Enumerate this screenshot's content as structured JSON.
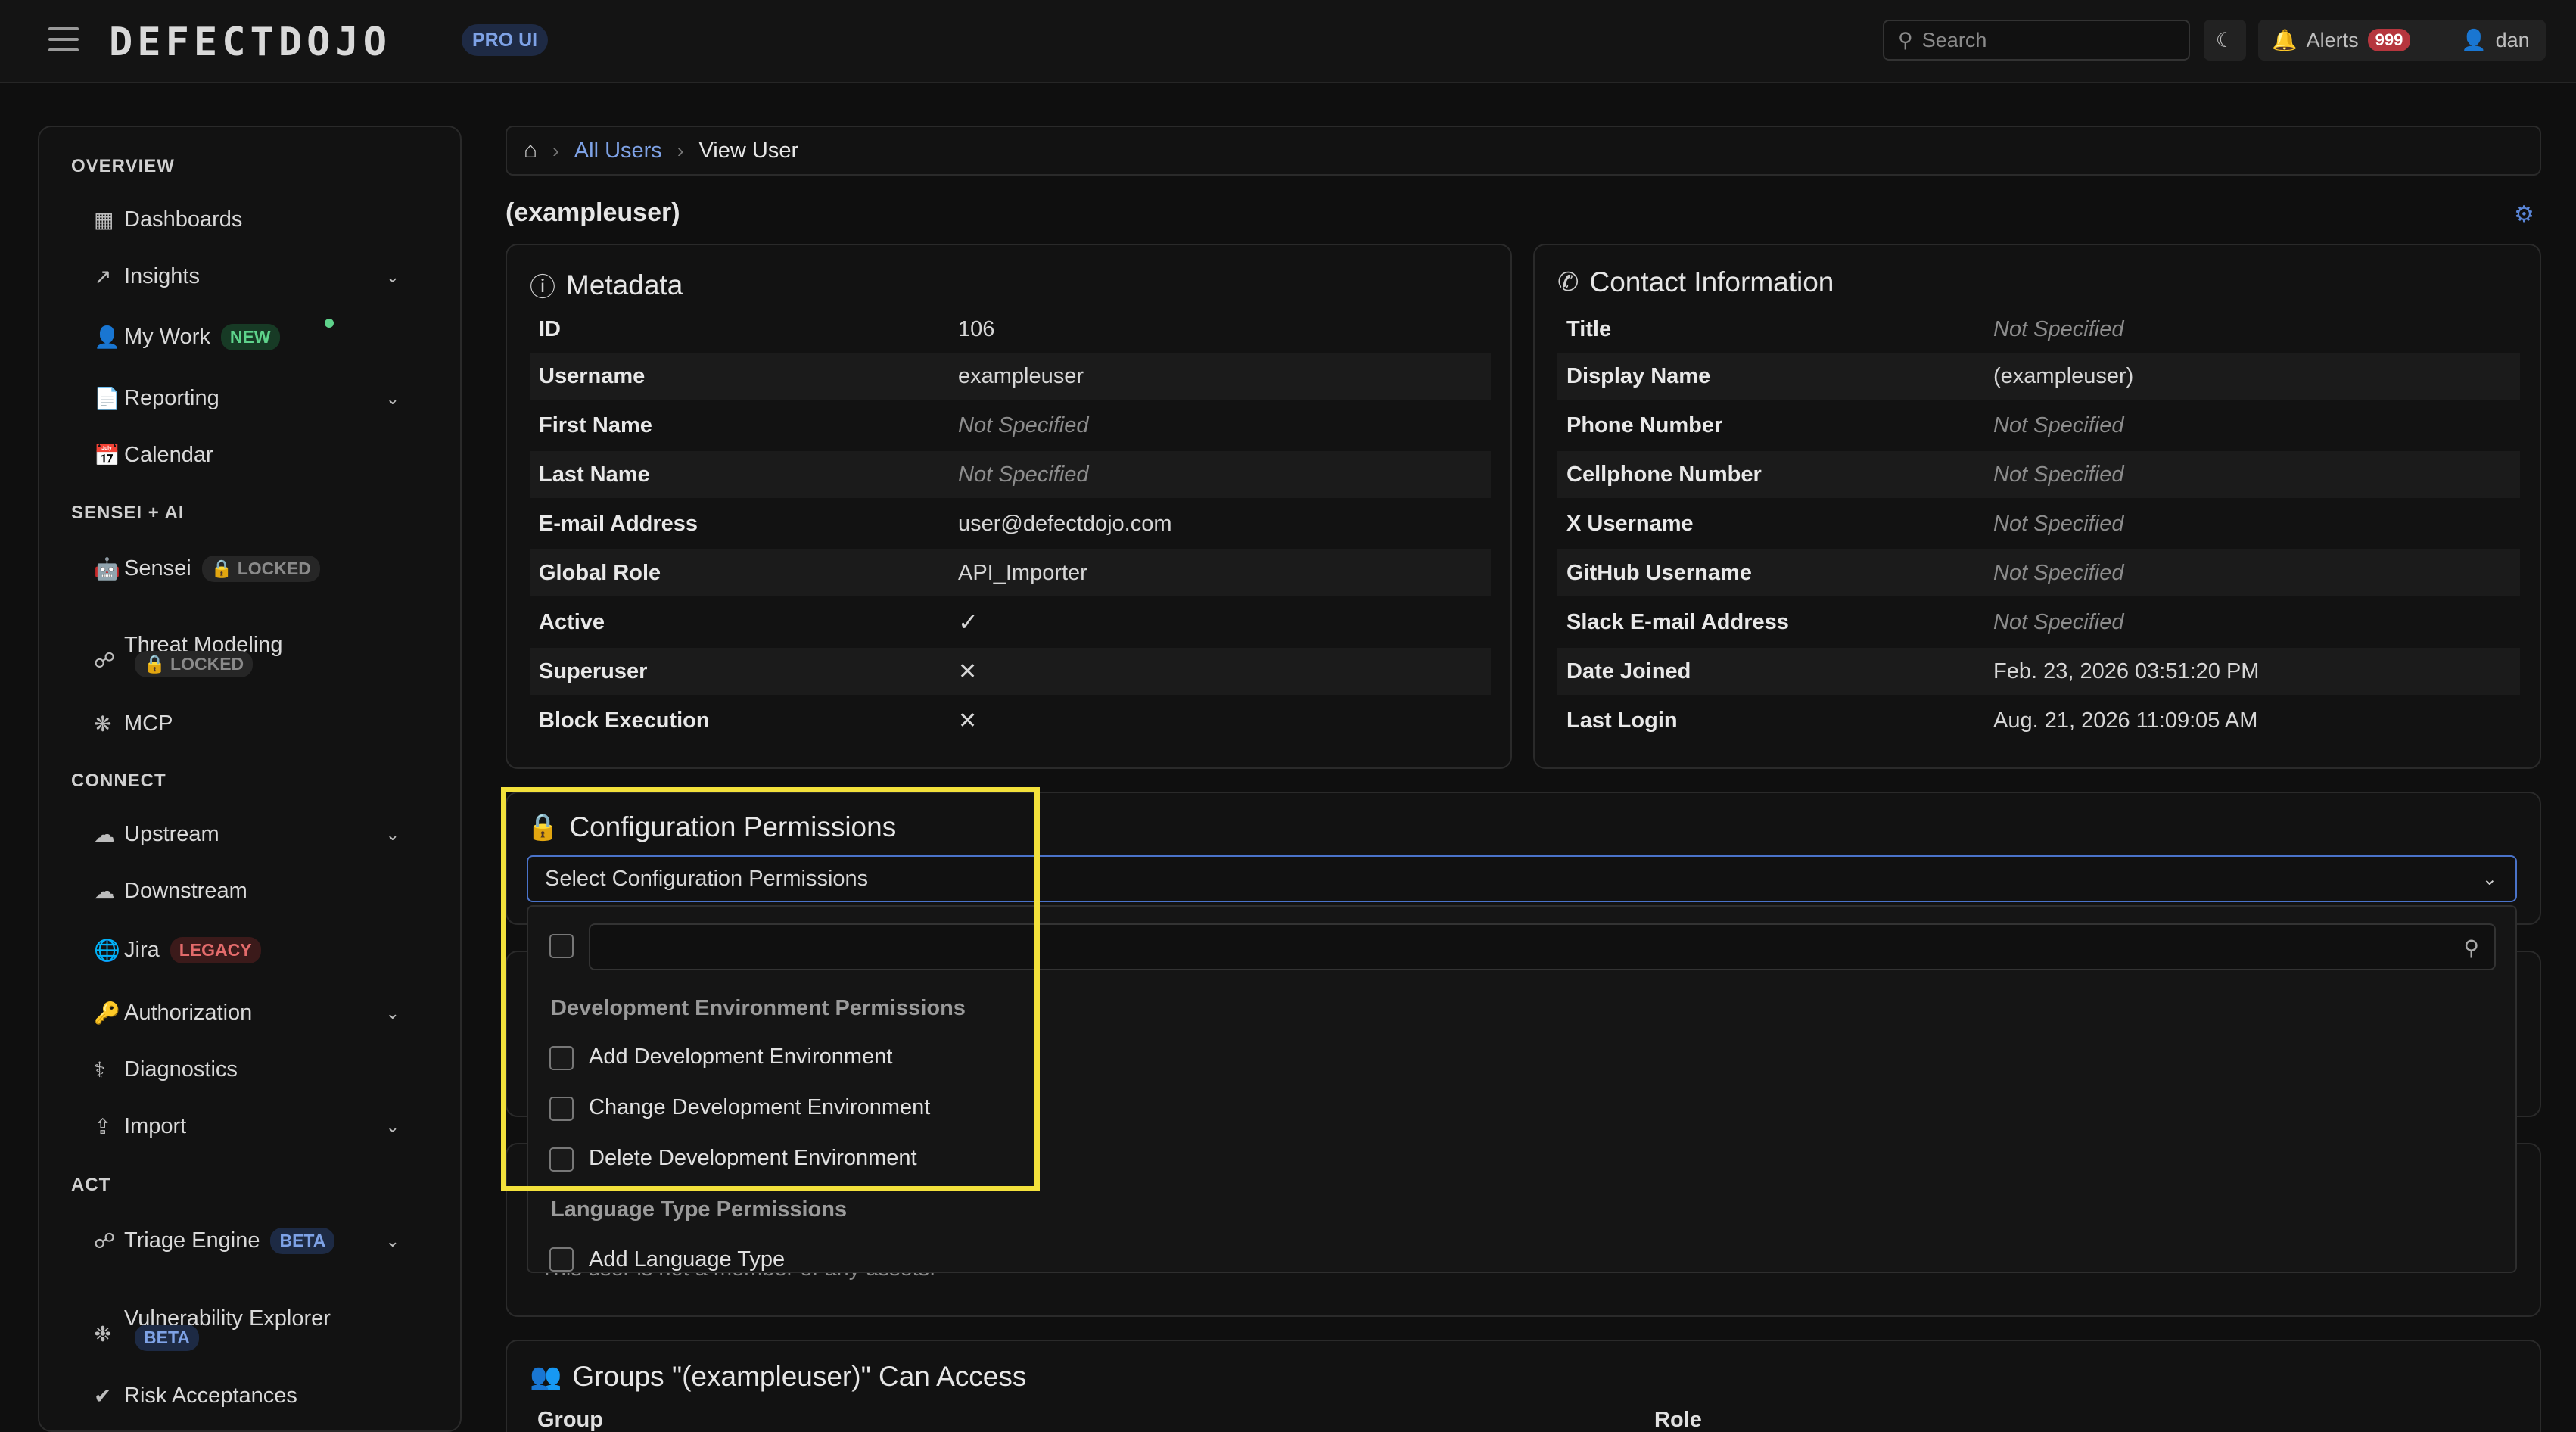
{
  "header": {
    "logo": "DEFECTDOJO",
    "badge": "PRO UI",
    "search_placeholder": "Search",
    "alerts_label": "Alerts",
    "alerts_count": "999",
    "user": "dan"
  },
  "sidebar": {
    "sections": {
      "overview": "OVERVIEW",
      "sensei": "SENSEI + AI",
      "connect": "CONNECT",
      "act": "ACT"
    },
    "items": {
      "dashboards": "Dashboards",
      "insights": "Insights",
      "my_work": "My Work",
      "my_work_tag": "NEW",
      "reporting": "Reporting",
      "calendar": "Calendar",
      "sensei": "Sensei",
      "sensei_tag": "LOCKED",
      "threat_modeling": "Threat Modeling",
      "threat_modeling_tag": "LOCKED",
      "mcp": "MCP",
      "upstream": "Upstream",
      "downstream": "Downstream",
      "jira": "Jira",
      "jira_tag": "LEGACY",
      "authorization": "Authorization",
      "diagnostics": "Diagnostics",
      "import": "Import",
      "triage_engine": "Triage Engine",
      "triage_engine_tag": "BETA",
      "vuln_explorer": "Vulnerability Explorer",
      "vuln_explorer_tag": "BETA",
      "risk_acceptances": "Risk Acceptances"
    }
  },
  "breadcrumb": {
    "all_users": "All Users",
    "current": "View User"
  },
  "page_title": "(exampleuser)",
  "metadata": {
    "title": "Metadata",
    "rows": [
      {
        "k": "ID",
        "v": "106"
      },
      {
        "k": "Username",
        "v": "exampleuser"
      },
      {
        "k": "First Name",
        "v": "Not Specified"
      },
      {
        "k": "Last Name",
        "v": "Not Specified"
      },
      {
        "k": "E-mail Address",
        "v": "user@defectdojo.com"
      },
      {
        "k": "Global Role",
        "v": "API_Importer"
      },
      {
        "k": "Active",
        "v": ""
      },
      {
        "k": "Superuser",
        "v": ""
      },
      {
        "k": "Block Execution",
        "v": ""
      }
    ]
  },
  "contact": {
    "title": "Contact Information",
    "rows": [
      {
        "k": "Title",
        "v": "Not Specified"
      },
      {
        "k": "Display Name",
        "v": "(exampleuser)"
      },
      {
        "k": "Phone Number",
        "v": "Not Specified"
      },
      {
        "k": "Cellphone Number",
        "v": "Not Specified"
      },
      {
        "k": "X Username",
        "v": "Not Specified"
      },
      {
        "k": "GitHub Username",
        "v": "Not Specified"
      },
      {
        "k": "Slack E-mail Address",
        "v": "Not Specified"
      },
      {
        "k": "Date Joined",
        "v": "Feb. 23, 2026 03:51:20 PM"
      },
      {
        "k": "Last Login",
        "v": "Aug. 21, 2026 11:09:05 AM"
      }
    ]
  },
  "config_permissions": {
    "title": "Configuration Permissions",
    "placeholder": "Select Configuration Permissions",
    "group_dev": "Development Environment Permissions",
    "opt_add_dev": "Add Development Environment",
    "opt_change_dev": "Change Development Environment",
    "opt_delete_dev": "Delete Development Environment",
    "group_lang": "Language Type Permissions",
    "opt_add_lang": "Add Language Type"
  },
  "assets_note": "This user is not a member of any assets.",
  "groups": {
    "title": "Groups \"(exampleuser)\" Can Access",
    "col_group": "Group",
    "col_role": "Role"
  }
}
